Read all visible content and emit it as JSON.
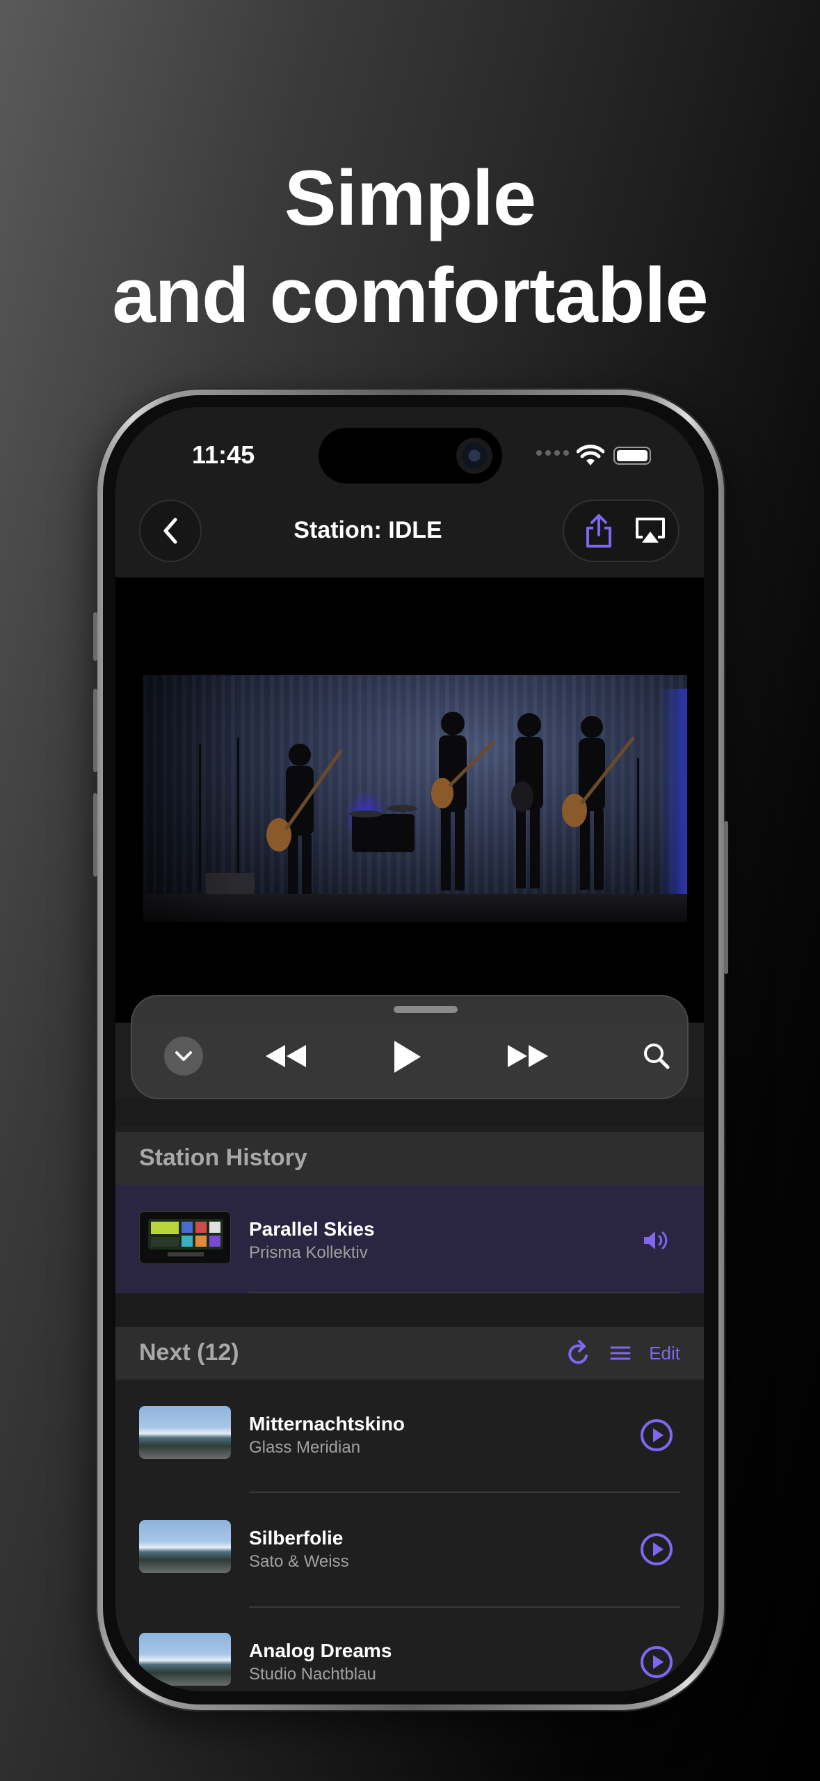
{
  "promo": {
    "headline_line1": "Simple",
    "headline_line2": "and comfortable"
  },
  "status_bar": {
    "time": "11:45"
  },
  "nav": {
    "title": "Station: IDLE"
  },
  "icons": {
    "back": "chevron-left-icon",
    "share": "share-icon",
    "airplay": "airplay-icon",
    "collapse": "chevron-down-icon",
    "rewind": "rewind-icon",
    "play": "play-icon",
    "fast_forward": "fast-forward-icon",
    "search": "search-icon",
    "speaker": "speaker-icon",
    "repeat": "repeat-icon",
    "queue": "list-icon"
  },
  "colors": {
    "accent": "#8066f0",
    "active_row": "#2a2540"
  },
  "history": {
    "section_title": "Station History",
    "items": [
      {
        "title": "Parallel Skies",
        "artist": "Prisma Kollektiv",
        "playing": true
      }
    ]
  },
  "next": {
    "section_title": "Next (12)",
    "edit_label": "Edit",
    "items": [
      {
        "title": "Mitternachtskino",
        "artist": "Glass Meridian"
      },
      {
        "title": "Silberfolie",
        "artist": "Sato & Weiss"
      },
      {
        "title": "Analog Dreams",
        "artist": "Studio Nachtblau"
      }
    ]
  }
}
